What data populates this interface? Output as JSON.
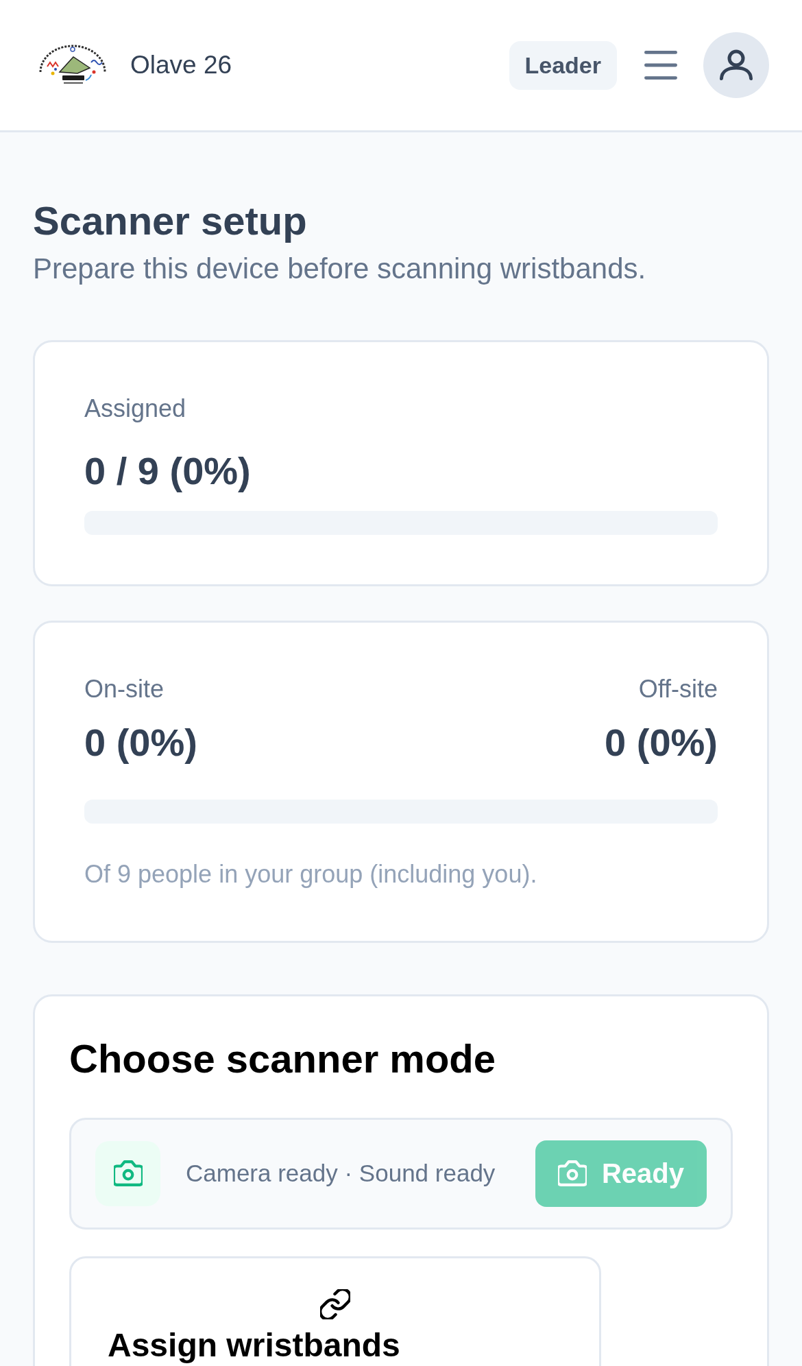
{
  "header": {
    "title": "Olave 26",
    "role_badge": "Leader"
  },
  "page": {
    "title": "Scanner setup",
    "subtitle": "Prepare this device before scanning wristbands."
  },
  "assigned_card": {
    "label": "Assigned",
    "value": "0 / 9 (0%)",
    "level": 0
  },
  "presence_card": {
    "stats": [
      {
        "label": "On-site",
        "value": "0 (0%)"
      },
      {
        "label": "Off-site",
        "value": "0 (0%)"
      }
    ],
    "level": 0,
    "note": "Of 9 people in your group (including you)."
  },
  "mode_card": {
    "title": "Choose scanner mode",
    "status": {
      "text": "Camera ready · Sound ready",
      "button": {
        "label": "Ready",
        "disabled": true
      }
    },
    "modes": [
      {
        "kind": "link",
        "label": "Assign wristbands"
      }
    ]
  }
}
